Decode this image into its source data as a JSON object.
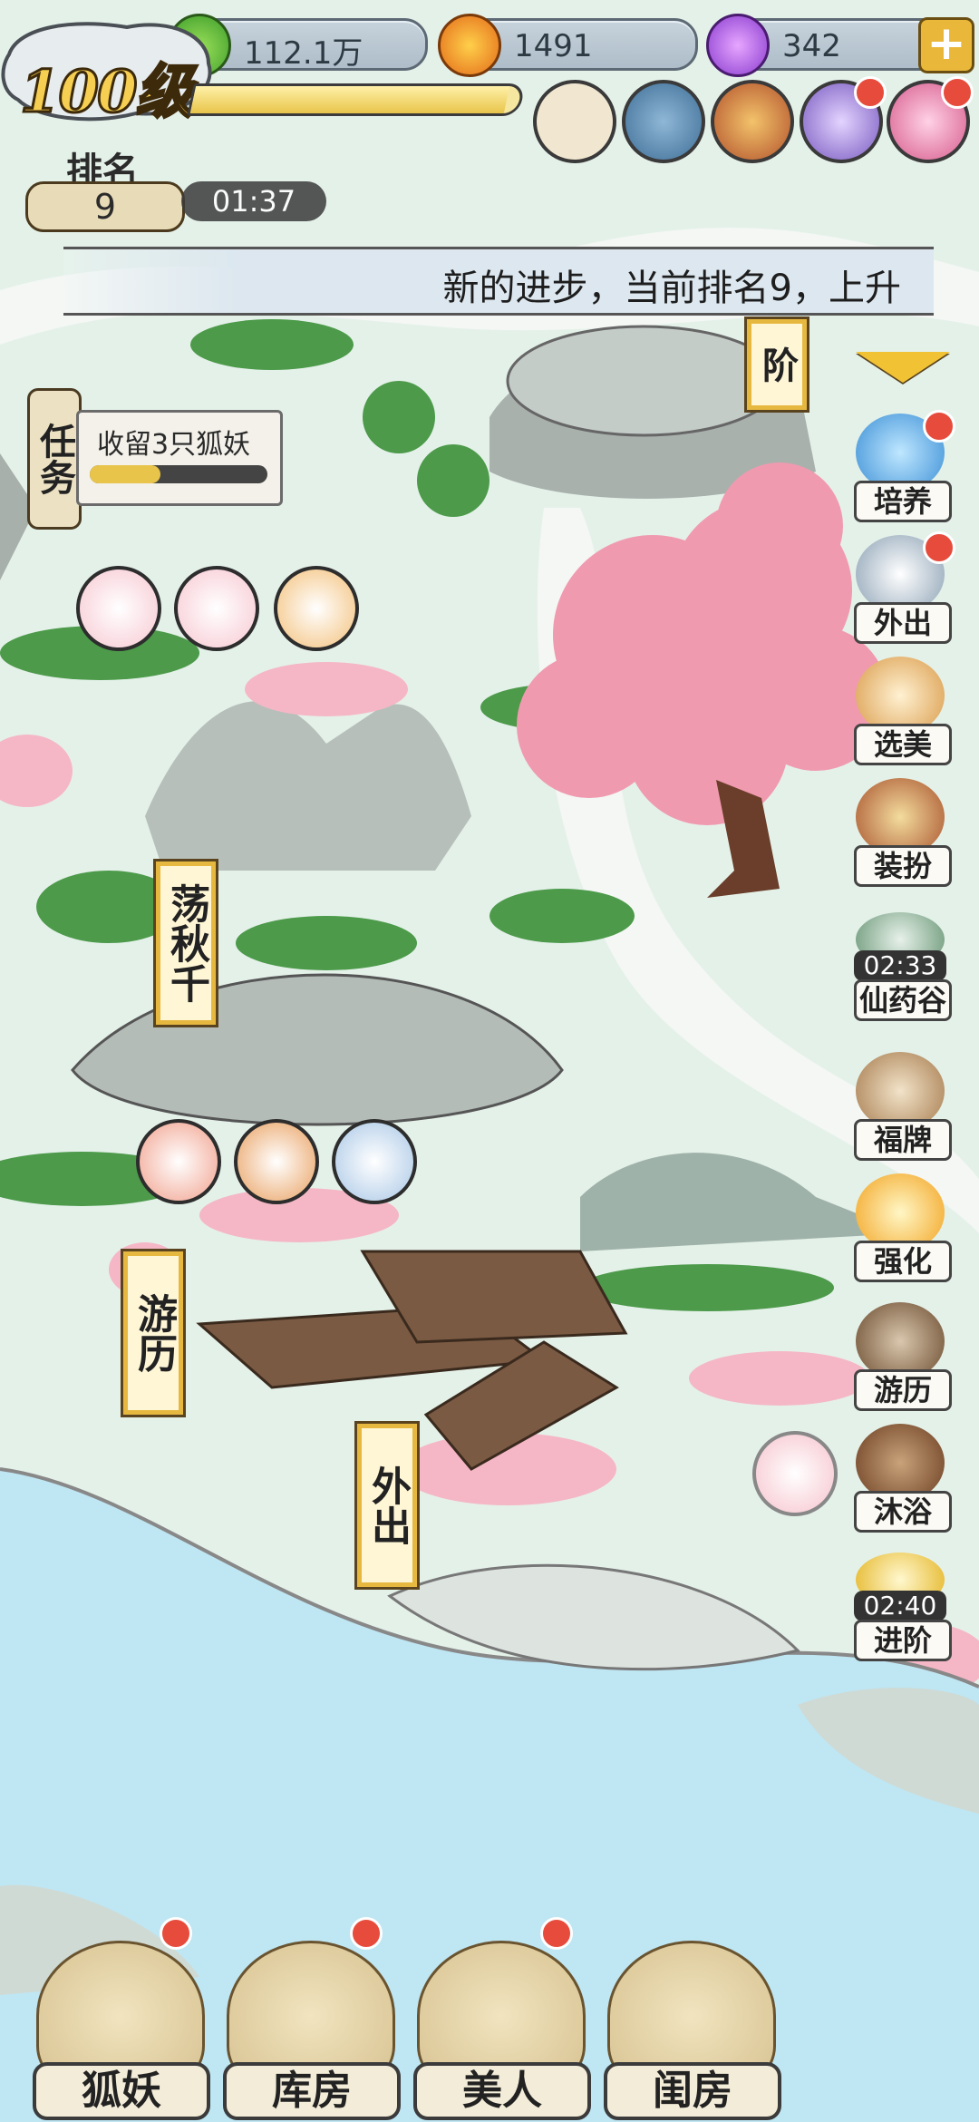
{
  "resources": {
    "jade": "112.1万",
    "coin": "1491",
    "gem": "342"
  },
  "player": {
    "level": "100级",
    "rank_label": "排名",
    "rank": "9",
    "timer": "01:37",
    "xp_fraction": 0.96
  },
  "notice": "新的进步，当前排名9，上升",
  "task": {
    "label": "任务",
    "text": "收留3只狐妖",
    "progress_fraction": 0.4
  },
  "map_signs": {
    "swing": "荡秋千",
    "travel": "游历",
    "outing": "外出",
    "advance_partial": "阶"
  },
  "right_menu": [
    {
      "label": "培养",
      "icon": "cultivate-icon",
      "dot": true
    },
    {
      "label": "外出",
      "icon": "mountain-icon",
      "dot": true
    },
    {
      "label": "选美",
      "icon": "beauty-contest-icon",
      "dot": false
    },
    {
      "label": "装扮",
      "icon": "mirror-icon",
      "dot": false
    },
    {
      "label": "仙药谷",
      "icon": "herb-valley-icon",
      "dot": false,
      "timer": "02:33"
    },
    {
      "label": "福牌",
      "icon": "fortune-plaque-icon",
      "dot": false
    },
    {
      "label": "强化",
      "icon": "flame-icon",
      "dot": false
    },
    {
      "label": "游历",
      "icon": "boat-icon",
      "dot": false
    },
    {
      "label": "沐浴",
      "icon": "bath-tub-icon",
      "dot": false
    },
    {
      "label": "进阶",
      "icon": "star-burst-icon",
      "dot": false,
      "timer": "02:40"
    }
  ],
  "bottom_nav": [
    {
      "label": "狐妖",
      "icon": "white-fox-icon"
    },
    {
      "label": "库房",
      "icon": "treasure-bag-icon"
    },
    {
      "label": "美人",
      "icon": "beauty-girl-icon"
    },
    {
      "label": "闺房",
      "icon": "boudoir-icon"
    }
  ],
  "colors": {
    "accent_gold": "#e6b840",
    "notification_red": "#e74b3c",
    "river": "#bfe6f3",
    "blossom": "#f2a6b8"
  }
}
